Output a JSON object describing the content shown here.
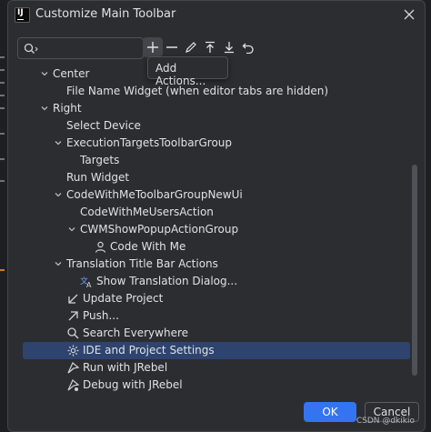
{
  "window": {
    "title": "Customize Main Toolbar"
  },
  "search": {
    "value": "",
    "placeholder": ""
  },
  "toolbar": {
    "popup_label": "Add Actions..."
  },
  "tree": [
    {
      "label": "Center",
      "icon": "",
      "chevron": "down",
      "indent": 1
    },
    {
      "label": "File Name Widget (when editor tabs are hidden)",
      "icon": "",
      "chevron": "",
      "indent": 2
    },
    {
      "label": "Right",
      "icon": "",
      "chevron": "down",
      "indent": 1
    },
    {
      "label": "Select Device",
      "icon": "",
      "chevron": "",
      "indent": 2
    },
    {
      "label": "ExecutionTargetsToolbarGroup",
      "icon": "",
      "chevron": "down",
      "indent": 2
    },
    {
      "label": "Targets",
      "icon": "",
      "chevron": "",
      "indent": 3
    },
    {
      "label": "Run Widget",
      "icon": "",
      "chevron": "",
      "indent": 2
    },
    {
      "label": "CodeWithMeToolbarGroupNewUi",
      "icon": "",
      "chevron": "down",
      "indent": 2
    },
    {
      "label": "CodeWithMeUsersAction",
      "icon": "",
      "chevron": "",
      "indent": 3
    },
    {
      "label": "CWMShowPopupActionGroup",
      "icon": "",
      "chevron": "down",
      "indent": 3
    },
    {
      "label": "Code With Me",
      "icon": "person-icon",
      "chevron": "",
      "indent": 4
    },
    {
      "label": "Translation Title Bar Actions",
      "icon": "",
      "chevron": "down",
      "indent": 2
    },
    {
      "label": "Show Translation Dialog...",
      "icon": "translate-icon",
      "chevron": "",
      "indent": 3
    },
    {
      "label": "Update Project",
      "icon": "arrow-down-left-icon",
      "chevron": "",
      "indent": 2
    },
    {
      "label": "Push...",
      "icon": "arrow-up-right-icon",
      "chevron": "",
      "indent": 2
    },
    {
      "label": "Search Everywhere",
      "icon": "search-icon",
      "chevron": "",
      "indent": 2
    },
    {
      "label": "IDE and Project Settings",
      "icon": "gear-icon",
      "chevron": "",
      "indent": 2,
      "selected": true
    },
    {
      "label": "Run with JRebel",
      "icon": "jrebel-run-icon",
      "chevron": "",
      "indent": 2
    },
    {
      "label": "Debug with JRebel",
      "icon": "jrebel-debug-icon",
      "chevron": "",
      "indent": 2
    }
  ],
  "buttons": {
    "ok": "OK",
    "cancel": "Cancel"
  },
  "watermark": "CSDN @dkikio",
  "colors": {
    "accent": "#3574f0",
    "selection": "#2e436e",
    "background": "#2b2d30"
  }
}
